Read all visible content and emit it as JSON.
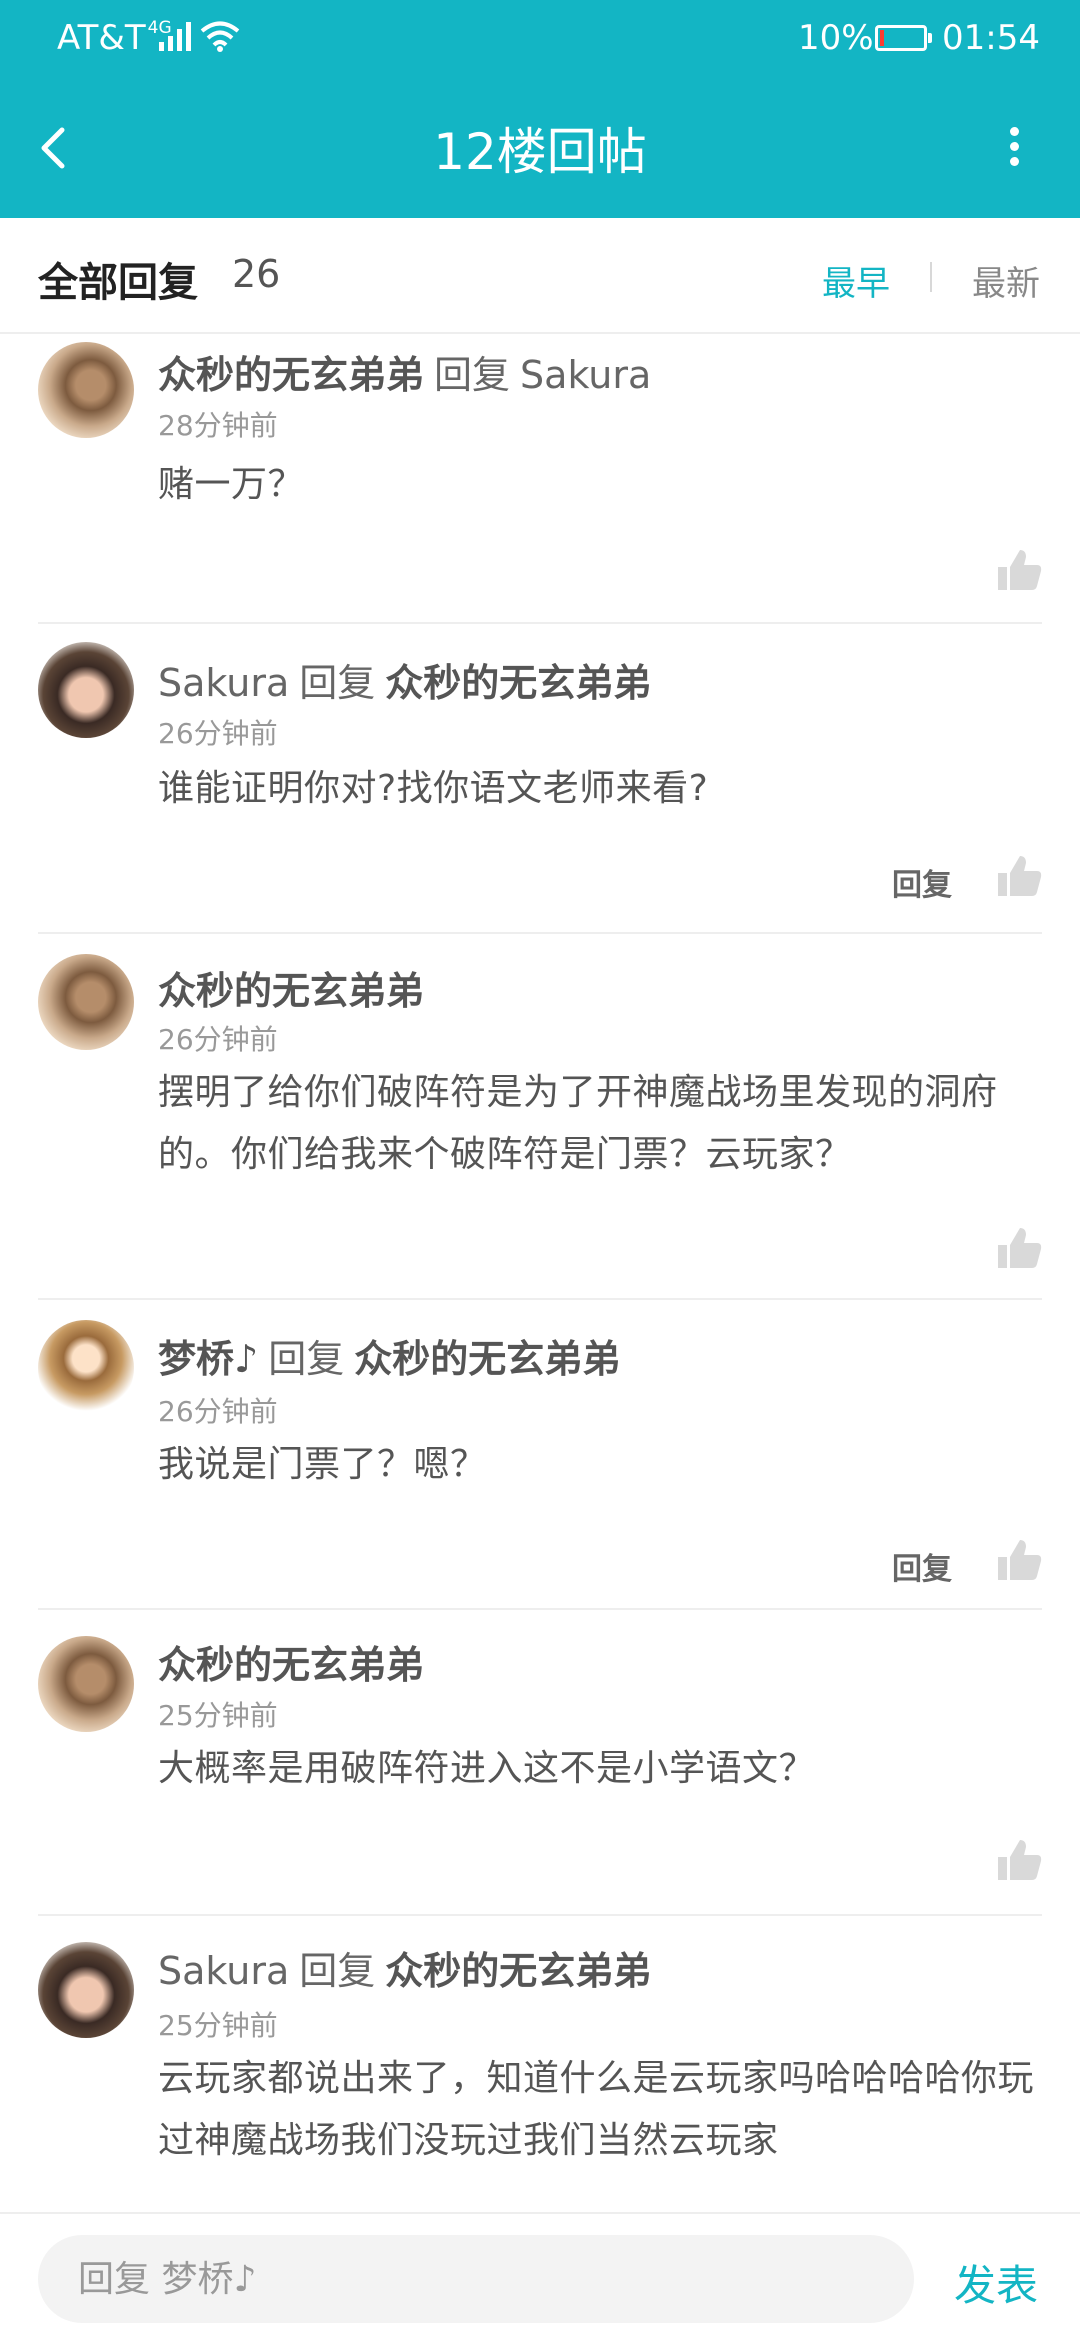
{
  "status_bar": {
    "carrier": "AT&T",
    "network": "4G",
    "battery_percent": "10%",
    "battery_level": 0.1,
    "time": "01:54"
  },
  "header": {
    "title": "12楼回帖",
    "back_icon": "chevron-left-icon",
    "more_icon": "vertical-dots-icon",
    "background_color": "#13b5c4"
  },
  "replies_header": {
    "label": "全部回复",
    "count": "26",
    "sort_earliest": "最早",
    "sort_latest": "最新",
    "active_sort": "最早",
    "accent_color": "#13b5c4"
  },
  "comments": [
    {
      "avatar": "cat-avatar",
      "author": "众秒的无玄弟弟",
      "reply_word": "回复",
      "reply_to": "Sakura",
      "time": "28分钟前",
      "text": "赌一万？",
      "reply_label": ""
    },
    {
      "avatar": "girl-avatar",
      "author": "Sakura",
      "reply_word": "回复",
      "reply_to": "众秒的无玄弟弟",
      "time": "26分钟前",
      "text": "谁能证明你对?找你语文老师来看?",
      "reply_label": "回复"
    },
    {
      "avatar": "cat-avatar",
      "author": "众秒的无玄弟弟",
      "reply_word": "",
      "reply_to": "",
      "time": "26分钟前",
      "text": "摆明了给你们破阵符是为了开神魔战场里发现的洞府的。你们给我来个破阵符是门票？云玩家？",
      "reply_label": ""
    },
    {
      "avatar": "anime-avatar",
      "author": "梦桥♪",
      "reply_word": "回复",
      "reply_to": "众秒的无玄弟弟",
      "time": "26分钟前",
      "text": "我说是门票了？嗯？",
      "reply_label": "回复"
    },
    {
      "avatar": "cat-avatar",
      "author": "众秒的无玄弟弟",
      "reply_word": "",
      "reply_to": "",
      "time": "25分钟前",
      "text": "大概率是用破阵符进入这不是小学语文？",
      "reply_label": ""
    },
    {
      "avatar": "girl-avatar",
      "author": "Sakura",
      "reply_word": "回复",
      "reply_to": "众秒的无玄弟弟",
      "time": "25分钟前",
      "text": "云玩家都说出来了，知道什么是云玩家吗哈哈哈哈你玩过神魔战场我们没玩过我们当然云玩家",
      "reply_label": ""
    }
  ],
  "composer": {
    "placeholder": "回复 梦桥♪",
    "send_label": "发表"
  }
}
